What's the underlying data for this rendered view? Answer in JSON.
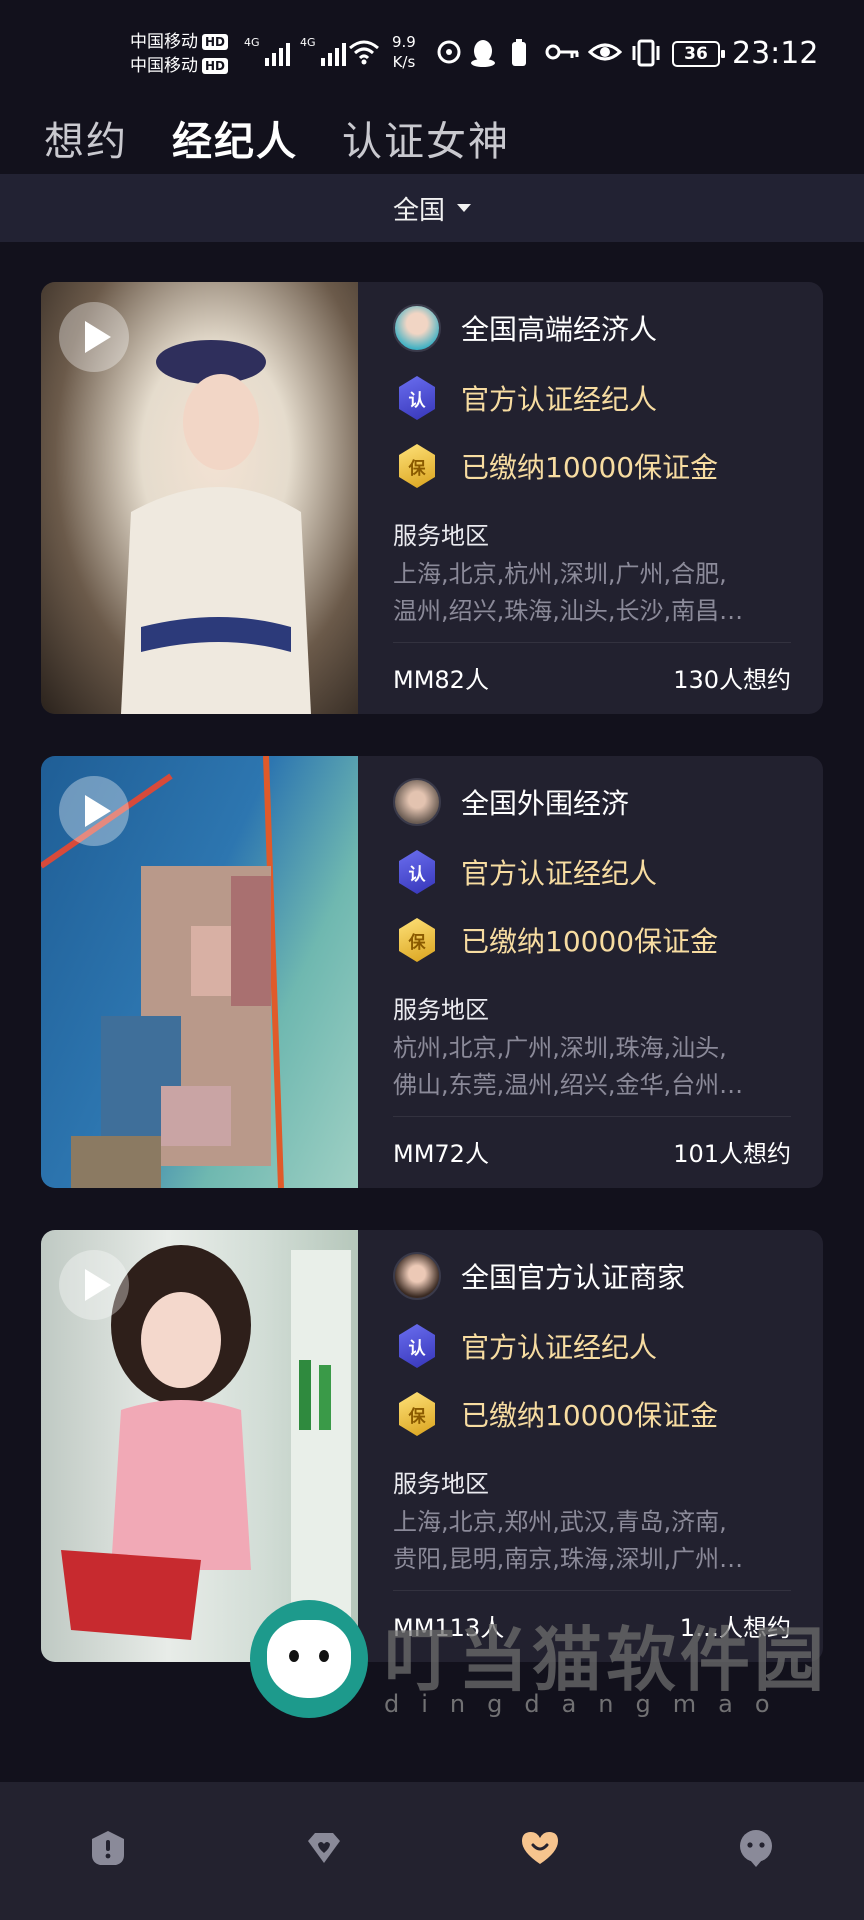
{
  "status_bar": {
    "carrier_1": "中国移动",
    "carrier_2": "中国移动",
    "hd": "HD",
    "network": "4G",
    "net_speed_value": "9.9",
    "net_speed_unit": "K/s",
    "battery": "36",
    "time": "23:12"
  },
  "tabs": [
    {
      "label": "想约",
      "active": false
    },
    {
      "label": "经纪人",
      "active": true
    },
    {
      "label": "认证女神",
      "active": false
    }
  ],
  "filter": {
    "region": "全国"
  },
  "cards": [
    {
      "title": "全国高端经济人",
      "verified_label": "官方认证经纪人",
      "verified_icon": "认",
      "deposit_label": "已缴纳10000保证金",
      "deposit_icon": "保",
      "area_label": "服务地区",
      "area_line_1": "上海,北京,杭州,深圳,广州,合肥,",
      "area_line_2": "温州,绍兴,珠海,汕头,长沙,南昌…",
      "members": "MM82人",
      "wants": "130人想约",
      "photo_colors": [
        "#e9e3d8",
        "#3a2f27"
      ]
    },
    {
      "title": "全国外围经济",
      "verified_label": "官方认证经纪人",
      "verified_icon": "认",
      "deposit_label": "已缴纳10000保证金",
      "deposit_icon": "保",
      "area_label": "服务地区",
      "area_line_1": "杭州,北京,广州,深圳,珠海,汕头,",
      "area_line_2": "佛山,东莞,温州,绍兴,金华,台州…",
      "members": "MM72人",
      "wants": "101人想约",
      "photo_colors": [
        "#2d6fa6",
        "#7ac0b8"
      ]
    },
    {
      "title": "全国官方认证商家",
      "verified_label": "官方认证经纪人",
      "verified_icon": "认",
      "deposit_label": "已缴纳10000保证金",
      "deposit_icon": "保",
      "area_label": "服务地区",
      "area_line_1": "上海,北京,郑州,武汉,青岛,济南,",
      "area_line_2": "贵阳,昆明,南京,珠海,深圳,广州…",
      "members": "MM113人",
      "wants": "1…人想约",
      "photo_colors": [
        "#f0c4c8",
        "#c9d7cf"
      ]
    }
  ],
  "watermark": {
    "cn": "叮当猫软件园",
    "en": "dingdangmao"
  },
  "bottom_nav": [
    {
      "icon": "alert-shield-icon",
      "active": false
    },
    {
      "icon": "heart-gem-icon",
      "active": false
    },
    {
      "icon": "heart-icon",
      "active": true
    },
    {
      "icon": "chat-face-icon",
      "active": false
    }
  ],
  "colors": {
    "background": "#12111c",
    "card": "#22212f",
    "accent_gold": "#f7dca1",
    "nav_active": "#f6c48e",
    "nav_inactive": "#8a8a99"
  }
}
